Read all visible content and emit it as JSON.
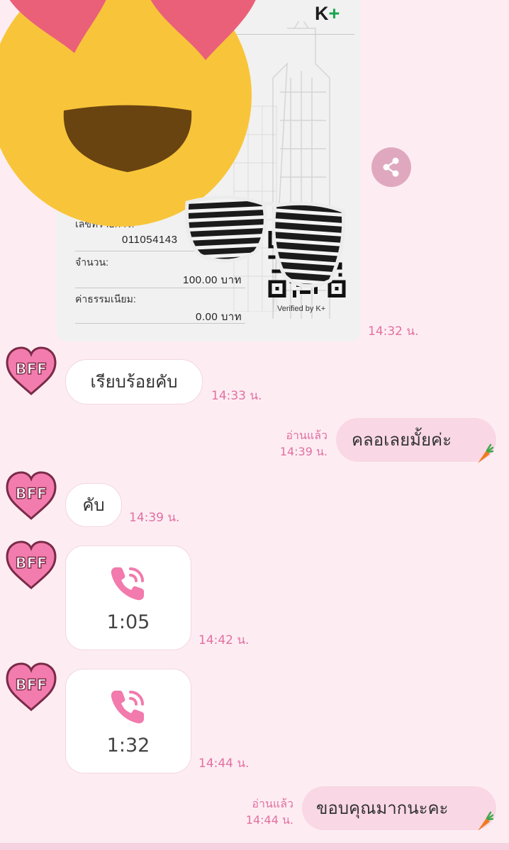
{
  "slip": {
    "brand": "K",
    "brand_plus": "+",
    "txn_label": "เลขที่รายการ:",
    "txn_value": "011054143",
    "amount_label": "จำนวน:",
    "amount_value": "100.00 บาท",
    "fee_label": "ค่าธรรมเนียม:",
    "fee_value": "0.00 บาท",
    "verified": "Verified by K+",
    "time": "14:32 น."
  },
  "messages": [
    {
      "side": "in",
      "text": "เรียบร้อยคับ",
      "time": "14:33 น."
    },
    {
      "side": "out",
      "text": "คลอเลยมั้ยค่ะ",
      "read": "อ่านแล้ว",
      "time": "14:39 น."
    },
    {
      "side": "in",
      "text": "คับ",
      "time": "14:39 น."
    },
    {
      "side": "in",
      "type": "call",
      "duration": "1:05",
      "time": "14:42 น."
    },
    {
      "side": "in",
      "type": "call",
      "duration": "1:32",
      "time": "14:44 น."
    },
    {
      "side": "out",
      "text": "ขอบคุณมากนะคะ",
      "read": "อ่านแล้ว",
      "time": "14:44 น."
    }
  ],
  "avatar_label": "BFF",
  "icons": {
    "share": "share-icon",
    "call": "phone-call-icon",
    "avatar": "bff-heart-avatar",
    "carrot": "carrot-sticker"
  },
  "colors": {
    "background": "#fdedf3",
    "outgoing_bubble": "#f9d7e4",
    "accent_pink": "#e36fa0",
    "avatar_pink": "#f37cae"
  }
}
